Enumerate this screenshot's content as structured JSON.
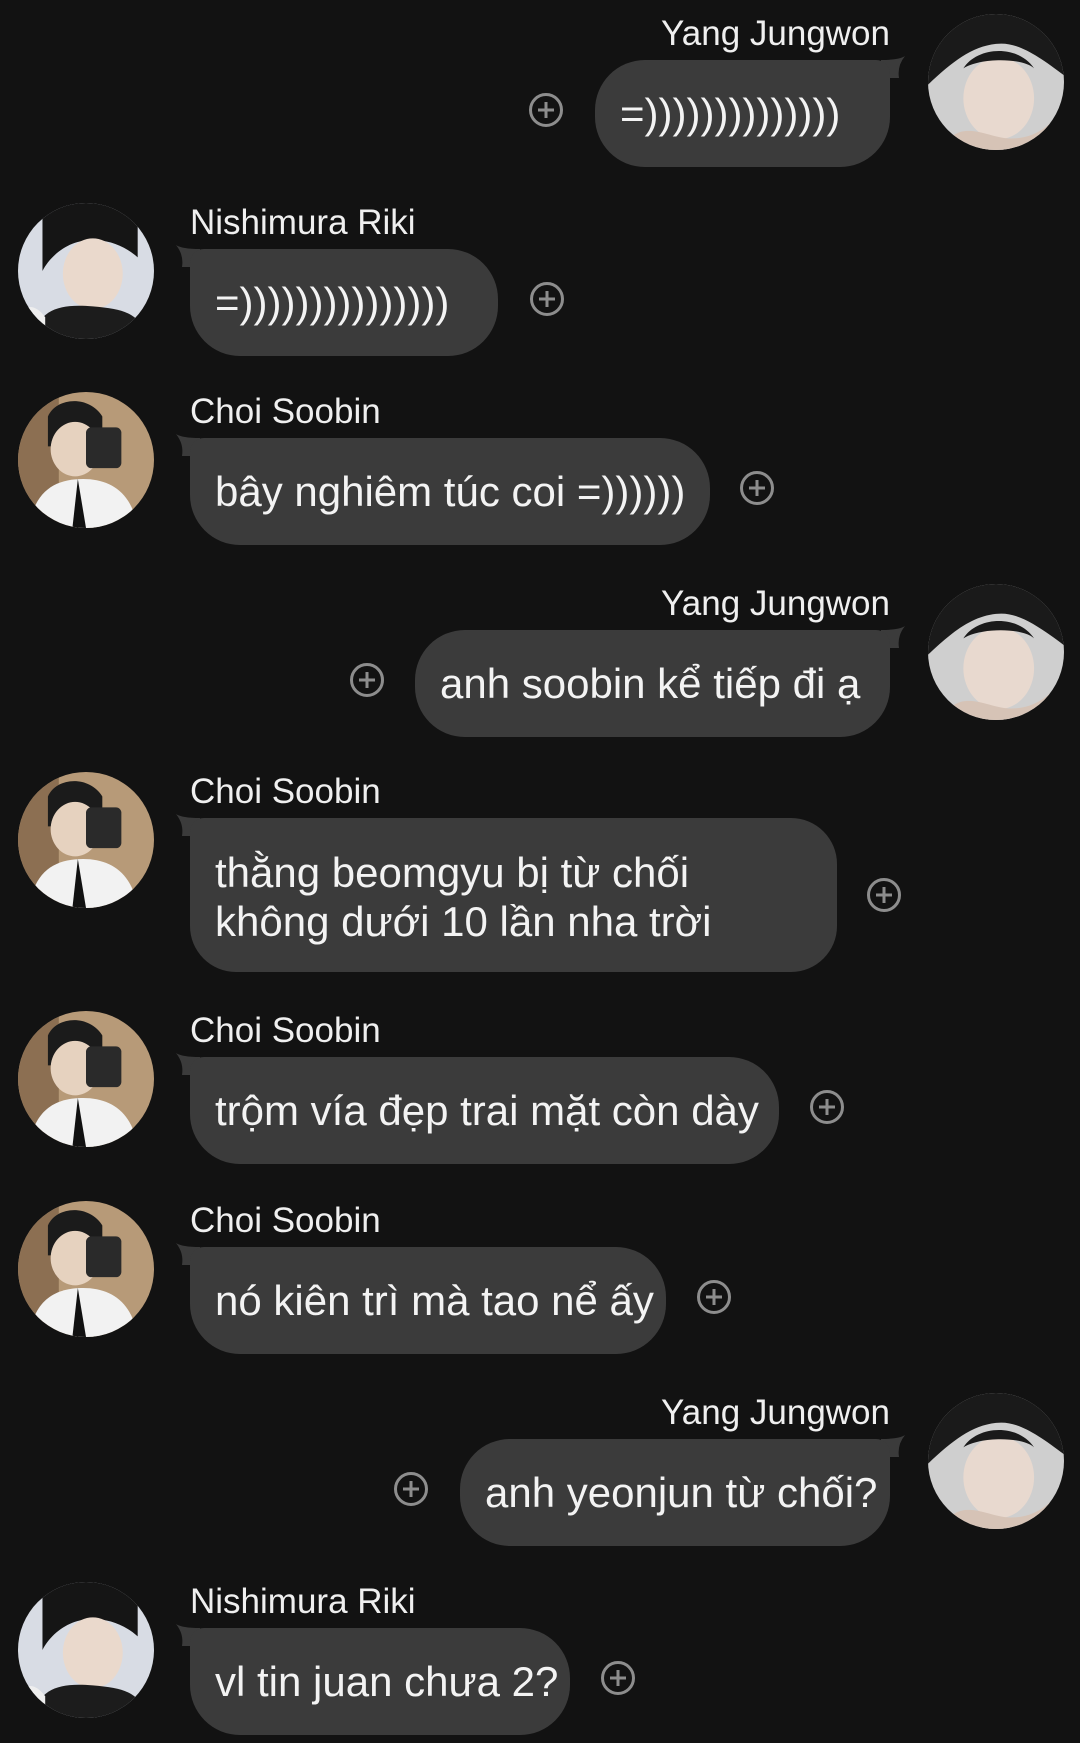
{
  "messages": [
    {
      "sender": "Yang Jungwon",
      "text": "=))))))))))))))",
      "side": "right"
    },
    {
      "sender": "Nishimura Riki",
      "text": "=)))))))))))))))",
      "side": "left"
    },
    {
      "sender": "Choi Soobin",
      "text": "bây nghiêm túc coi =))))))",
      "side": "left"
    },
    {
      "sender": "Yang Jungwon",
      "text": "anh soobin kể tiếp đi ạ",
      "side": "right"
    },
    {
      "sender": "Choi Soobin",
      "text": "thằng beomgyu bị từ chối không dưới 10 lần nha trời",
      "side": "left"
    },
    {
      "sender": "Choi Soobin",
      "text": "trộm vía đẹp trai mặt còn dày",
      "side": "left"
    },
    {
      "sender": "Choi Soobin",
      "text": "nó kiên trì mà tao nể ấy",
      "side": "left"
    },
    {
      "sender": "Yang Jungwon",
      "text": "anh yeonjun từ chối?",
      "side": "right"
    },
    {
      "sender": "Nishimura Riki",
      "text": "vl tin juan chưa 2?",
      "side": "left"
    }
  ],
  "icons": {
    "react": "add-reaction-icon",
    "avatar": "profile-photo"
  },
  "colors": {
    "background": "#121212",
    "bubble": "#3b3b3b",
    "text": "#f3f3f3"
  }
}
